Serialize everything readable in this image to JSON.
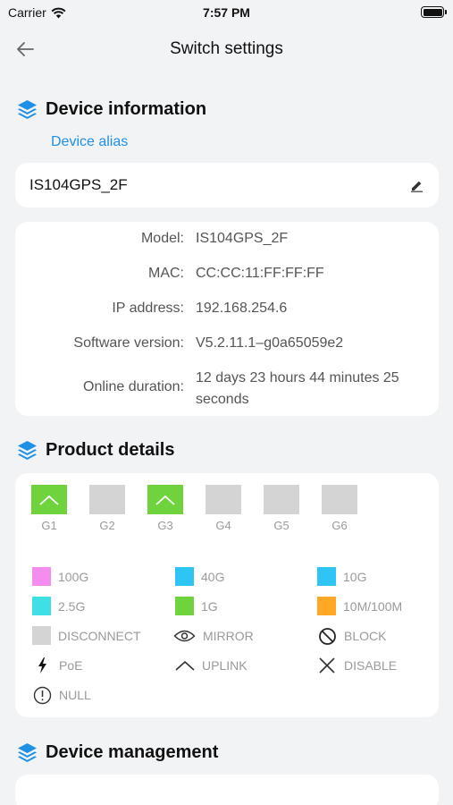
{
  "status_bar": {
    "carrier": "Carrier",
    "time": "7:57 PM"
  },
  "nav": {
    "title": "Switch settings"
  },
  "device_info": {
    "section_title": "Device information",
    "alias_label": "Device alias",
    "alias_value": "IS104GPS_2F",
    "rows": [
      {
        "key": "Model:",
        "value": "IS104GPS_2F"
      },
      {
        "key": "MAC:",
        "value": "CC:CC:11:FF:FF:FF"
      },
      {
        "key": "IP address:",
        "value": "192.168.254.6"
      },
      {
        "key": "Software version:",
        "value": "V5.2.11.1–g0a65059e2"
      },
      {
        "key": "Online duration:",
        "value": "12 days 23 hours 44 minutes 25 seconds"
      }
    ]
  },
  "product_details": {
    "section_title": "Product details",
    "ports": [
      {
        "label": "G1",
        "state": "uplink",
        "color": "#6fd33d"
      },
      {
        "label": "G2",
        "state": "disconnect",
        "color": "#d4d4d4"
      },
      {
        "label": "G3",
        "state": "uplink",
        "color": "#6fd33d"
      },
      {
        "label": "G4",
        "state": "disconnect",
        "color": "#d4d4d4"
      },
      {
        "label": "G5",
        "state": "disconnect",
        "color": "#d4d4d4"
      },
      {
        "label": "G6",
        "state": "disconnect",
        "color": "#d4d4d4"
      }
    ],
    "legend": [
      {
        "label": "100G",
        "color": "#f58cf0"
      },
      {
        "label": "40G",
        "color": "#2ec5f5"
      },
      {
        "label": "10G",
        "color": "#2ec5f5"
      },
      {
        "label": "2.5G",
        "color": "#3ee0e6"
      },
      {
        "label": "1G",
        "color": "#6fd33d"
      },
      {
        "label": "10M/100M",
        "color": "#ffa825"
      },
      {
        "label": "DISCONNECT",
        "color": "#d4d4d4"
      },
      {
        "label": "MIRROR",
        "icon": "eye-icon"
      },
      {
        "label": "BLOCK",
        "icon": "block-icon"
      },
      {
        "label": "PoE",
        "icon": "lightning-icon"
      },
      {
        "label": "UPLINK",
        "icon": "uplink-chevron-icon"
      },
      {
        "label": "DISABLE",
        "icon": "x-icon"
      },
      {
        "label": "NULL",
        "icon": "exclamation-circle-icon"
      }
    ]
  },
  "device_management": {
    "section_title": "Device management"
  },
  "colors": {
    "accent": "#1e90e6",
    "background": "#f2f3f5",
    "card": "#ffffff"
  }
}
